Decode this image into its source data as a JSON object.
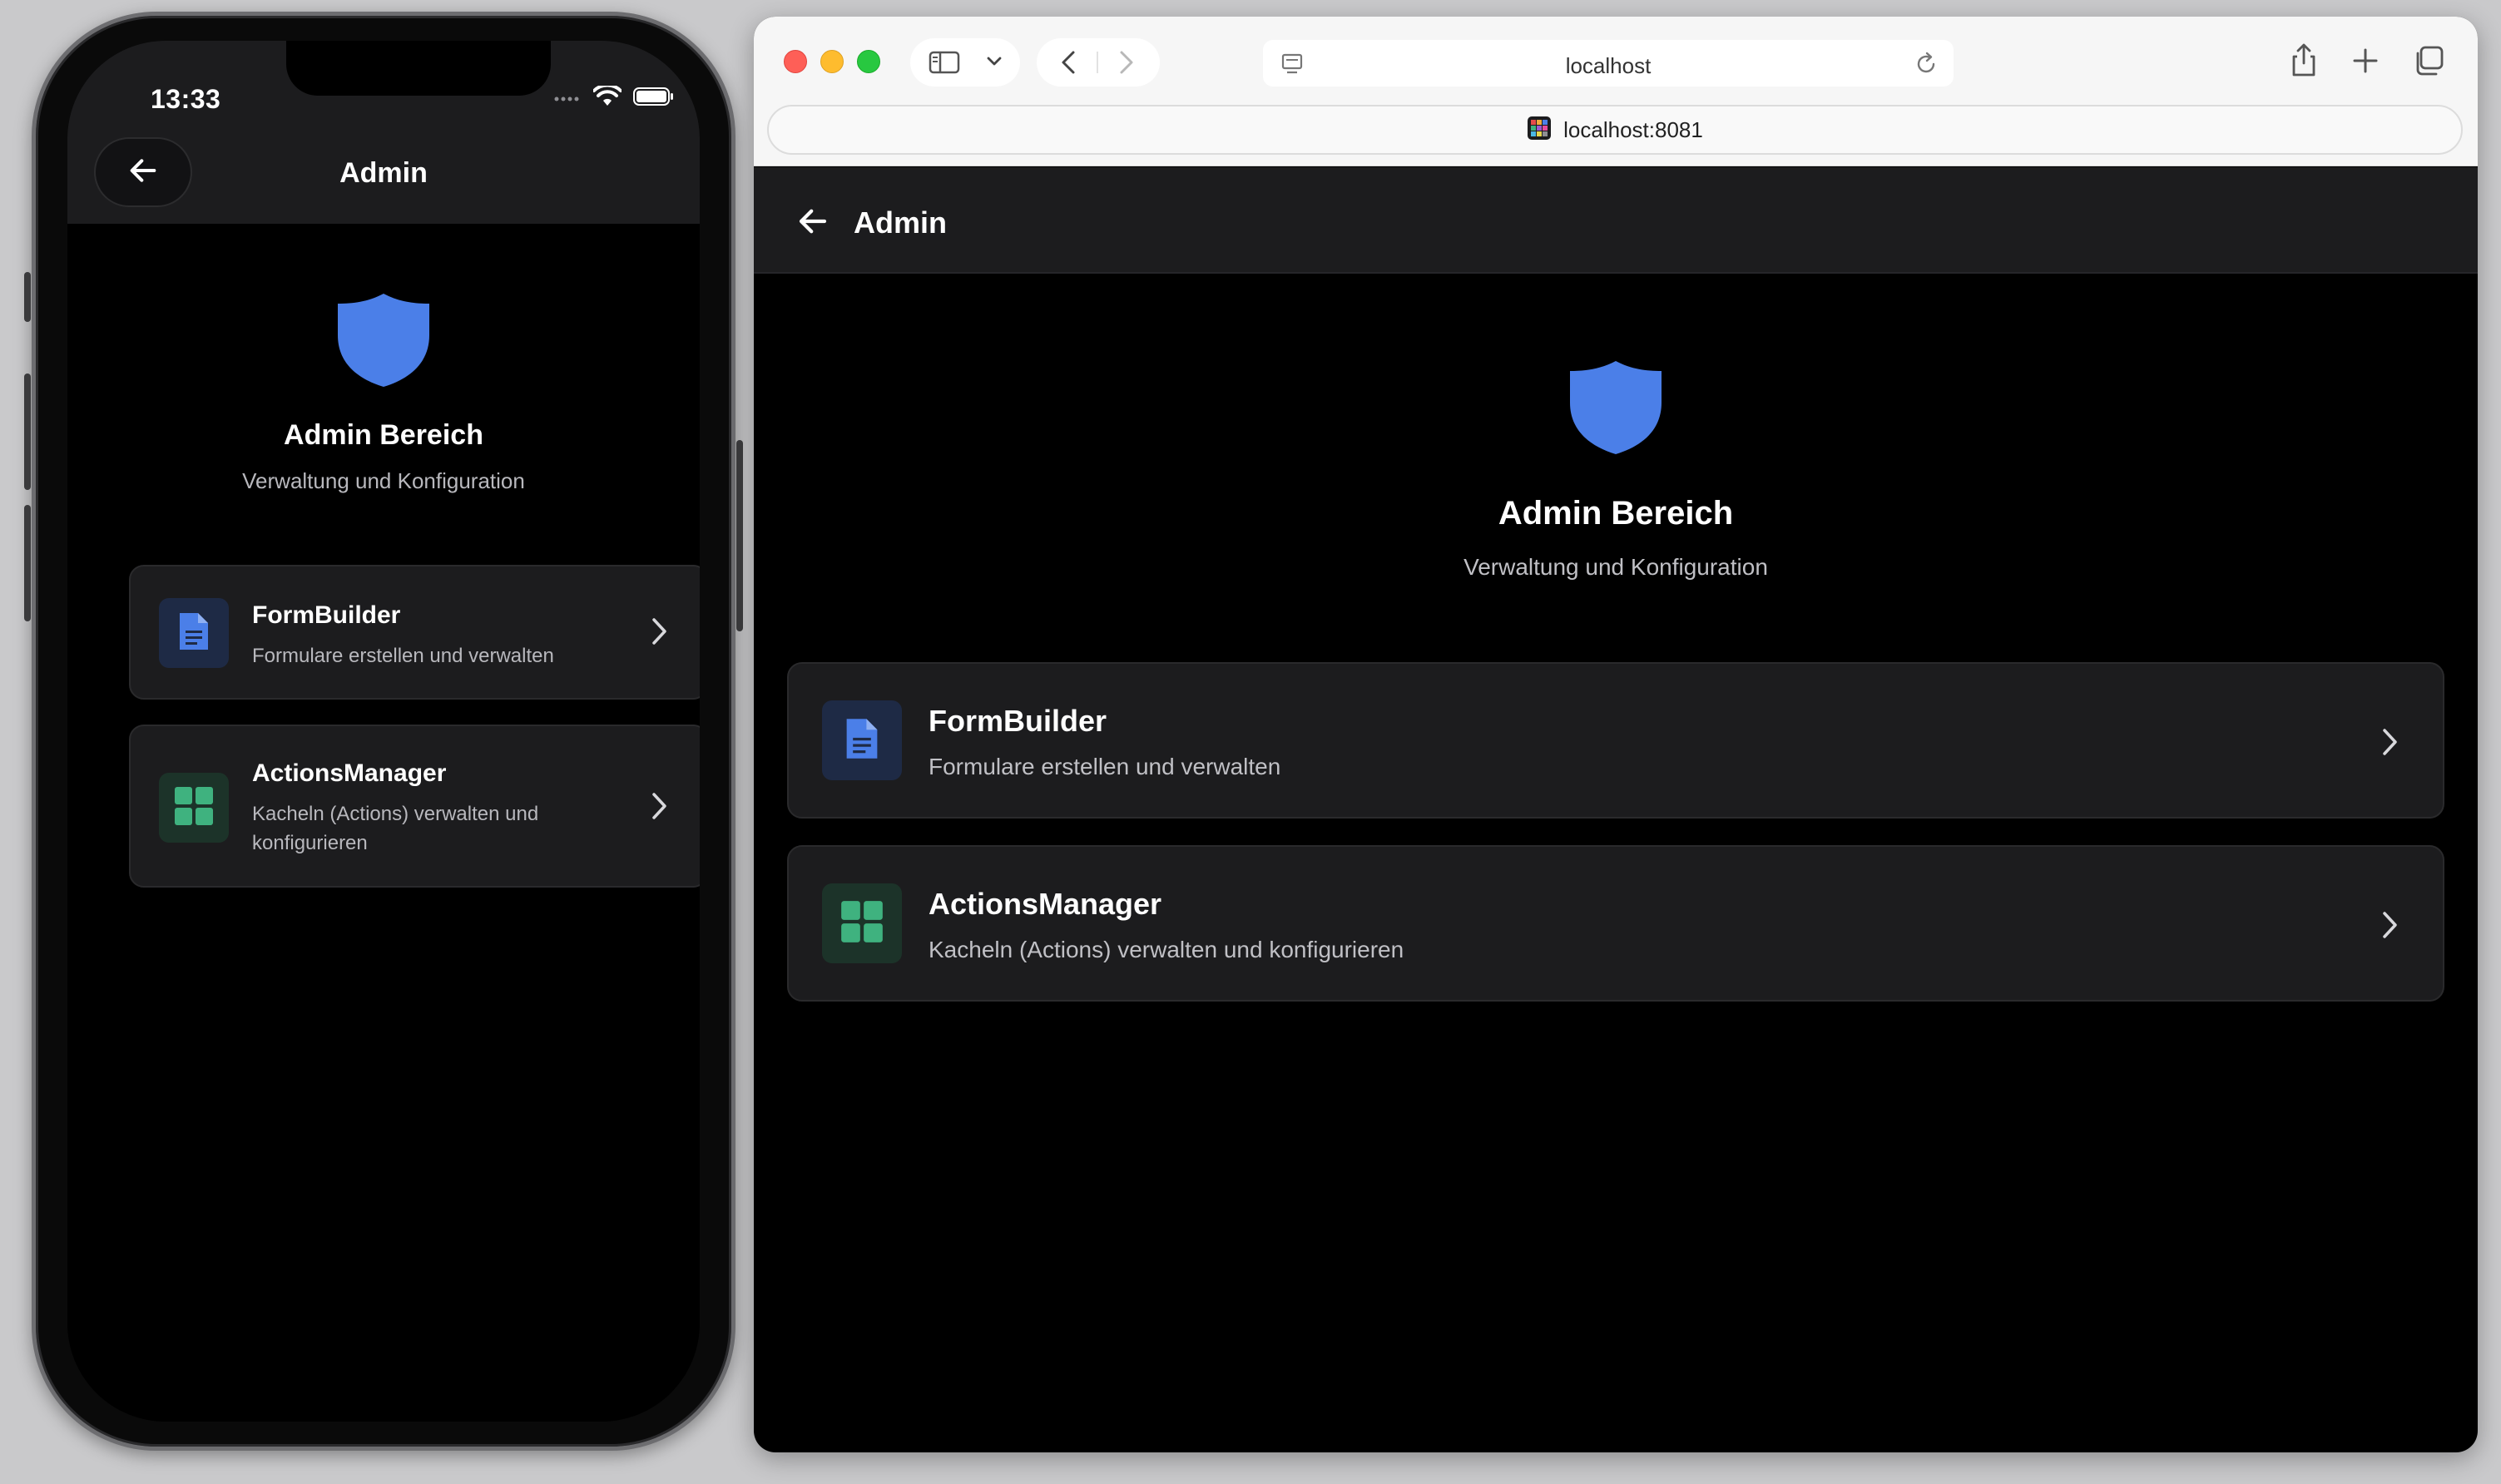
{
  "colors": {
    "accent_blue": "#4b7fe8",
    "accent_green": "#3fb27f",
    "card_bg": "#1c1c1e",
    "screen_bg": "#000000"
  },
  "phone": {
    "status": {
      "time": "13:33"
    },
    "header": {
      "title": "Admin",
      "back_icon": "arrow-left-icon"
    },
    "hero": {
      "icon": "shield-icon",
      "title": "Admin Bereich",
      "subtitle": "Verwaltung und Konfiguration"
    },
    "items": [
      {
        "icon": "document-icon",
        "title": "FormBuilder",
        "description": "Formulare erstellen und verwalten"
      },
      {
        "icon": "grid-icon",
        "title": "ActionsManager",
        "description": "Kacheln (Actions) verwalten und konfigurieren"
      }
    ]
  },
  "browser": {
    "tab_host": "localhost",
    "address": "localhost:8081",
    "header": {
      "title": "Admin",
      "back_icon": "arrow-left-icon"
    },
    "hero": {
      "icon": "shield-icon",
      "title": "Admin Bereich",
      "subtitle": "Verwaltung und Konfiguration"
    },
    "items": [
      {
        "icon": "document-icon",
        "title": "FormBuilder",
        "description": "Formulare erstellen und verwalten"
      },
      {
        "icon": "grid-icon",
        "title": "ActionsManager",
        "description": "Kacheln (Actions) verwalten und konfigurieren"
      }
    ]
  }
}
